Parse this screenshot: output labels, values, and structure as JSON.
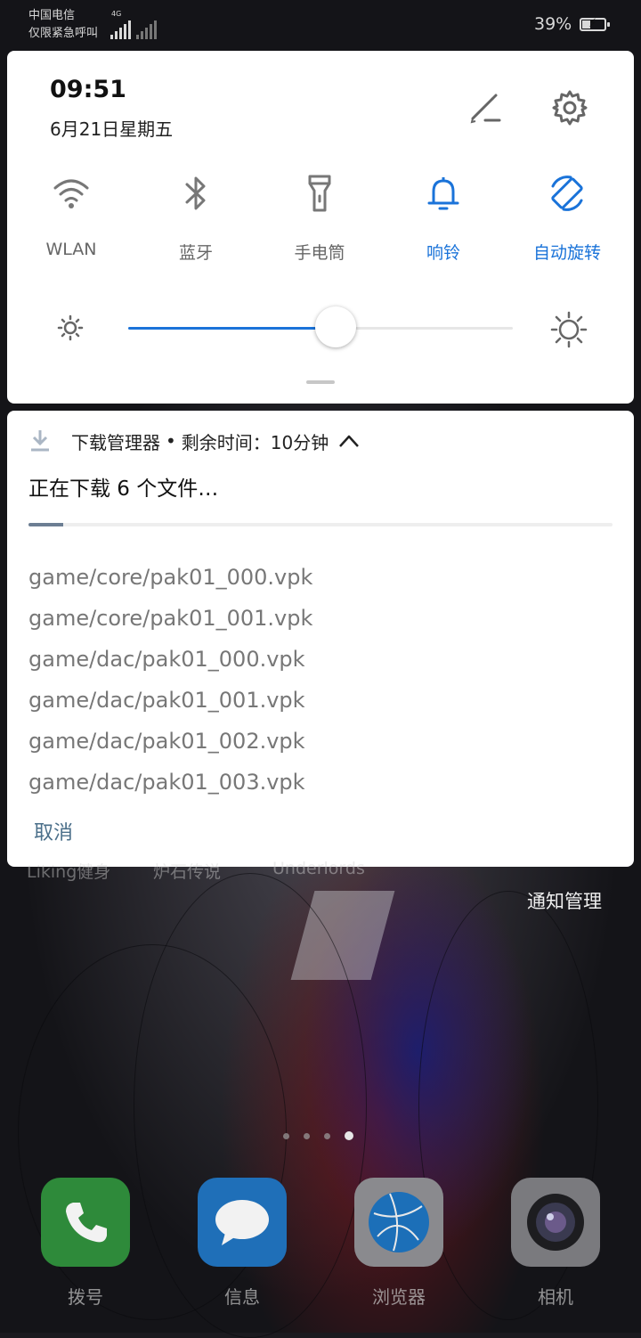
{
  "status_bar": {
    "carrier_line1": "中国电信",
    "carrier_line2": "仅限紧急呼叫",
    "network_type": "4G",
    "battery_percent": "39%",
    "battery_level": 0.39,
    "charging": true
  },
  "quick_settings": {
    "time": "09:51",
    "date": "6月21日星期五",
    "edit_icon": "pencil-icon",
    "settings_icon": "gear-icon",
    "tiles": [
      {
        "label": "WLAN",
        "icon": "wifi-icon",
        "active": false
      },
      {
        "label": "蓝牙",
        "icon": "bluetooth-icon",
        "active": false
      },
      {
        "label": "手电筒",
        "icon": "flashlight-icon",
        "active": false
      },
      {
        "label": "响铃",
        "icon": "bell-icon",
        "active": true
      },
      {
        "label": "自动旋转",
        "icon": "auto-rotate-icon",
        "active": true
      }
    ],
    "brightness_level": 0.54,
    "accent_color": "#1a73d9"
  },
  "notification": {
    "app_name": "下载管理器",
    "separator": "•",
    "time_remaining": "剩余时间：10分钟",
    "title": "正在下载 6 个文件…",
    "progress": 0.06,
    "files": [
      "game/core/pak01_000.vpk",
      "game/core/pak01_001.vpk",
      "game/dac/pak01_000.vpk",
      "game/dac/pak01_001.vpk",
      "game/dac/pak01_002.vpk",
      "game/dac/pak01_003.vpk"
    ],
    "cancel_label": "取消"
  },
  "notification_management_label": "通知管理",
  "obscured_app_labels": [
    "Liking健身",
    "炉石传说",
    "Underlords"
  ],
  "home": {
    "page_count": 4,
    "active_page": 4,
    "dock": [
      {
        "label": "拨号",
        "icon": "phone-icon"
      },
      {
        "label": "信息",
        "icon": "message-icon"
      },
      {
        "label": "浏览器",
        "icon": "browser-icon"
      },
      {
        "label": "相机",
        "icon": "camera-icon"
      }
    ]
  }
}
